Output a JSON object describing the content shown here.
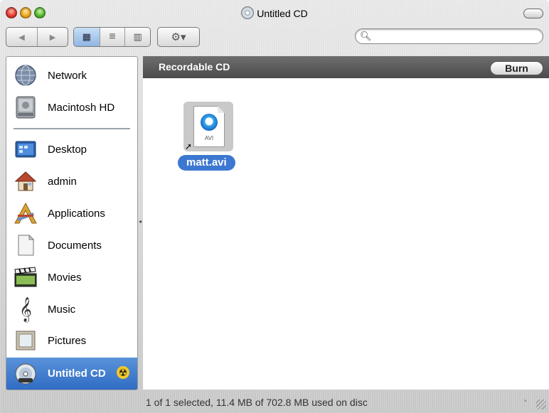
{
  "window": {
    "title": "Untitled CD"
  },
  "toolbar": {
    "back_label": "◀",
    "forward_label": "▶",
    "view_icons": "▦",
    "view_list": "≡",
    "view_columns": "▥",
    "action_label": "⚙▾",
    "search_placeholder": ""
  },
  "sidebar": {
    "items": [
      {
        "label": "Network",
        "icon": "network-globe-icon"
      },
      {
        "label": "Macintosh HD",
        "icon": "hard-drive-icon"
      },
      {
        "label": "Desktop",
        "icon": "desktop-folder-icon"
      },
      {
        "label": "admin",
        "icon": "home-icon"
      },
      {
        "label": "Applications",
        "icon": "applications-icon"
      },
      {
        "label": "Documents",
        "icon": "documents-icon"
      },
      {
        "label": "Movies",
        "icon": "clapperboard-icon"
      },
      {
        "label": "Music",
        "icon": "treble-clef-icon"
      },
      {
        "label": "Pictures",
        "icon": "picture-frame-icon"
      },
      {
        "label": "Untitled CD",
        "icon": "cd-icon",
        "selected": true
      }
    ]
  },
  "content": {
    "header_title": "Recordable CD",
    "burn_label": "Burn",
    "files": [
      {
        "name": "matt.avi",
        "type_label": "AVI",
        "selected": true
      }
    ]
  },
  "status": {
    "text": "1 of 1 selected, 11.4 MB of 702.8 MB used on disc"
  },
  "colors": {
    "selection_blue": "#3c78d1",
    "header_dark": "#555555"
  }
}
